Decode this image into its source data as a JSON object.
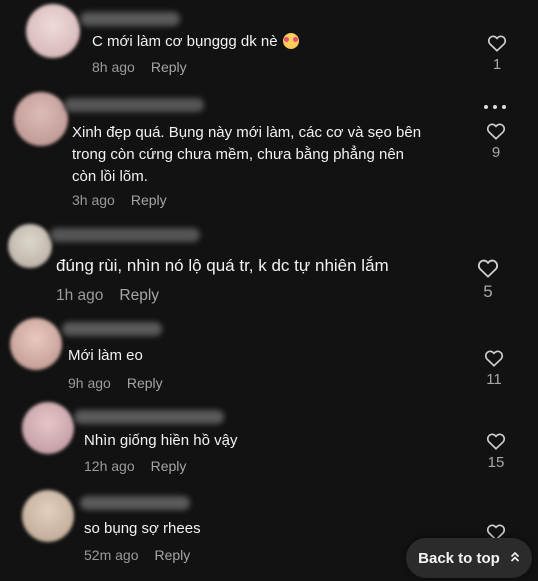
{
  "comments": [
    {
      "text": "C mới làm cơ bụnggg dk nè",
      "emoji": "blush-face-emoji",
      "time": "8h ago",
      "reply": "Reply",
      "likes": "1",
      "avatar_color": "#e3c8c8"
    },
    {
      "text_lines": [
        "Xinh đẹp quá. Bụng này mới làm, các cơ và sẹo bên",
        "trong còn cứng chưa mềm, chưa bằng phẳng nên",
        "còn lồi lõm."
      ],
      "time": "3h ago",
      "reply": "Reply",
      "likes": "9",
      "avatar_color": "#cfa9a4"
    },
    {
      "text": "đúng rùi, nhìn nó lộ quá tr, k dc tự nhiên lắm",
      "time": "1h ago",
      "reply": "Reply",
      "likes": "5",
      "avatar_color": "#c9c1b6"
    },
    {
      "text": "Mới làm eo",
      "time": "9h ago",
      "reply": "Reply",
      "likes": "11",
      "avatar_color": "#d8b5ad"
    },
    {
      "text": "Nhìn giống hiền hồ vậy",
      "time": "12h ago",
      "reply": "Reply",
      "likes": "15",
      "avatar_color": "#d4b3b6"
    },
    {
      "text": "so bụng sợ rhees",
      "time": "52m ago",
      "reply": "Reply",
      "likes": "",
      "avatar_color": "#cdb8a6"
    }
  ],
  "back_to_top": "Back to top",
  "icons": {
    "like": "heart-outline-icon",
    "more": "more-dots-icon",
    "back_top": "chevron-up-double-icon"
  }
}
